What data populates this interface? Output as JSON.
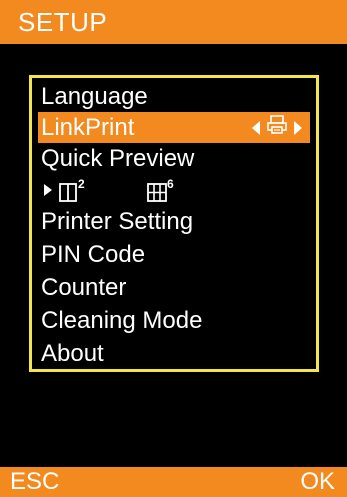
{
  "header": {
    "title": "SETUP",
    "color": "#f38a1f"
  },
  "menu": {
    "frame_color": "#f2e64a",
    "items": [
      {
        "label": "Language"
      },
      {
        "label": "LinkPrint",
        "selected": true,
        "icon": "printer-icon"
      },
      {
        "label": "Quick Preview"
      },
      {
        "label": "Printer Setting"
      },
      {
        "label": "PIN Code"
      },
      {
        "label": "Counter"
      },
      {
        "label": "Cleaning Mode"
      },
      {
        "label": "About"
      }
    ],
    "quick_preview_options": [
      {
        "icon": "layout-2-icon",
        "badge": "2",
        "selected": true
      },
      {
        "icon": "layout-6-icon",
        "badge": "6"
      }
    ]
  },
  "footer": {
    "left": "ESC",
    "right": "OK"
  }
}
